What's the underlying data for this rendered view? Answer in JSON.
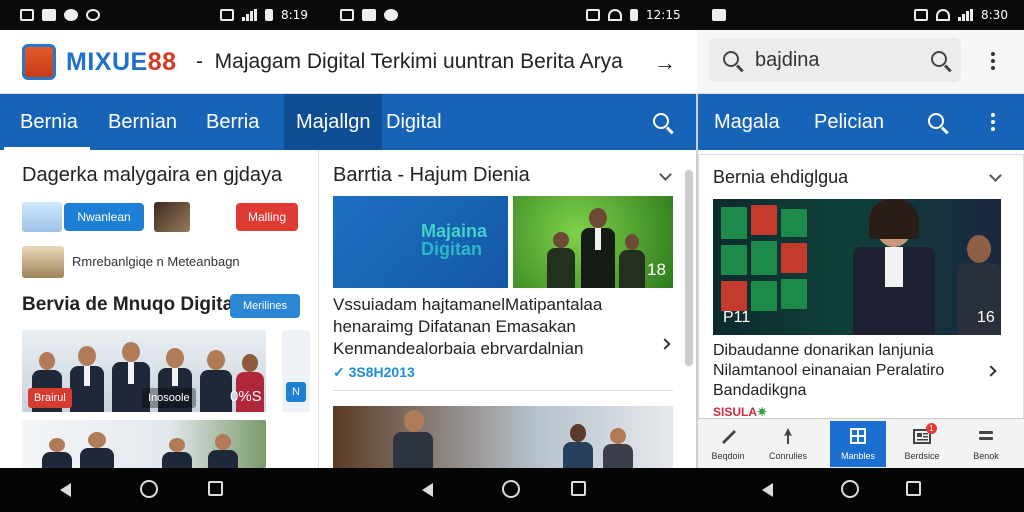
{
  "status_bar": {
    "time_left": "8:19",
    "time_mid": "12:15",
    "time_right": "8:30"
  },
  "app": {
    "logo_text": "MIXUE",
    "logo_num": "88",
    "title_dash": "-",
    "site_title": "Majagam Digital Terkimi uuntran Berita Arya"
  },
  "search": {
    "value": "bajdina"
  },
  "tabs": [
    {
      "label": "Bernia"
    },
    {
      "label": "Bernian"
    },
    {
      "label": "Berria"
    },
    {
      "label": "Majallgn"
    },
    {
      "label": "Digital"
    }
  ],
  "right_tabs": [
    {
      "label": "Magala"
    },
    {
      "label": "Pelician"
    }
  ],
  "col1": {
    "heading": "Dagerka malygaira en gjdaya",
    "chip_blue": "Nwanlean",
    "chip_red": "Malling",
    "row2_text": "Rmrebanlgiqe n Meteanbagn",
    "section_title": "Bervia de Mnuqo Digital",
    "section_badge": "Merilines",
    "photo_tag": "Brairul",
    "photo_tag2": "Inosoole",
    "photo_num": "0%S",
    "side_tag": "N"
  },
  "col2": {
    "heading": "Barrtia - Hajum Dienia",
    "hero_text_1": "Majaina",
    "hero_text_2": "Digitan",
    "hero2_num": "18",
    "headline": "Vssuiadam hajtamanelMatipantalaa henaraimg Difatanan Emasakan Kenmandealorbaia ebrvardalnian",
    "meta": "3S8H2013"
  },
  "col3": {
    "heading": "Bernia ehdiglgua",
    "hero_num_left": "P11",
    "hero_num_right": "16",
    "headline": "Dibaudanne donarikan lanjunia Nilamtanool einanaian Peralatiro Bandadikgna",
    "tag": "SISULA"
  },
  "bottom_nav": [
    {
      "label": "Beqdoin",
      "icon": "pen-icon"
    },
    {
      "label": "Conrulies",
      "icon": "pin-icon"
    },
    {
      "label": "Manbles",
      "icon": "grid-icon"
    },
    {
      "label": "Berdsice",
      "icon": "newspaper-icon",
      "badge": "1"
    },
    {
      "label": "Benok",
      "icon": "menu-icon"
    }
  ],
  "colors": {
    "brand_blue": "#1763b8",
    "active_tab": "#0f4e95",
    "accent_red": "#d12d3a"
  }
}
